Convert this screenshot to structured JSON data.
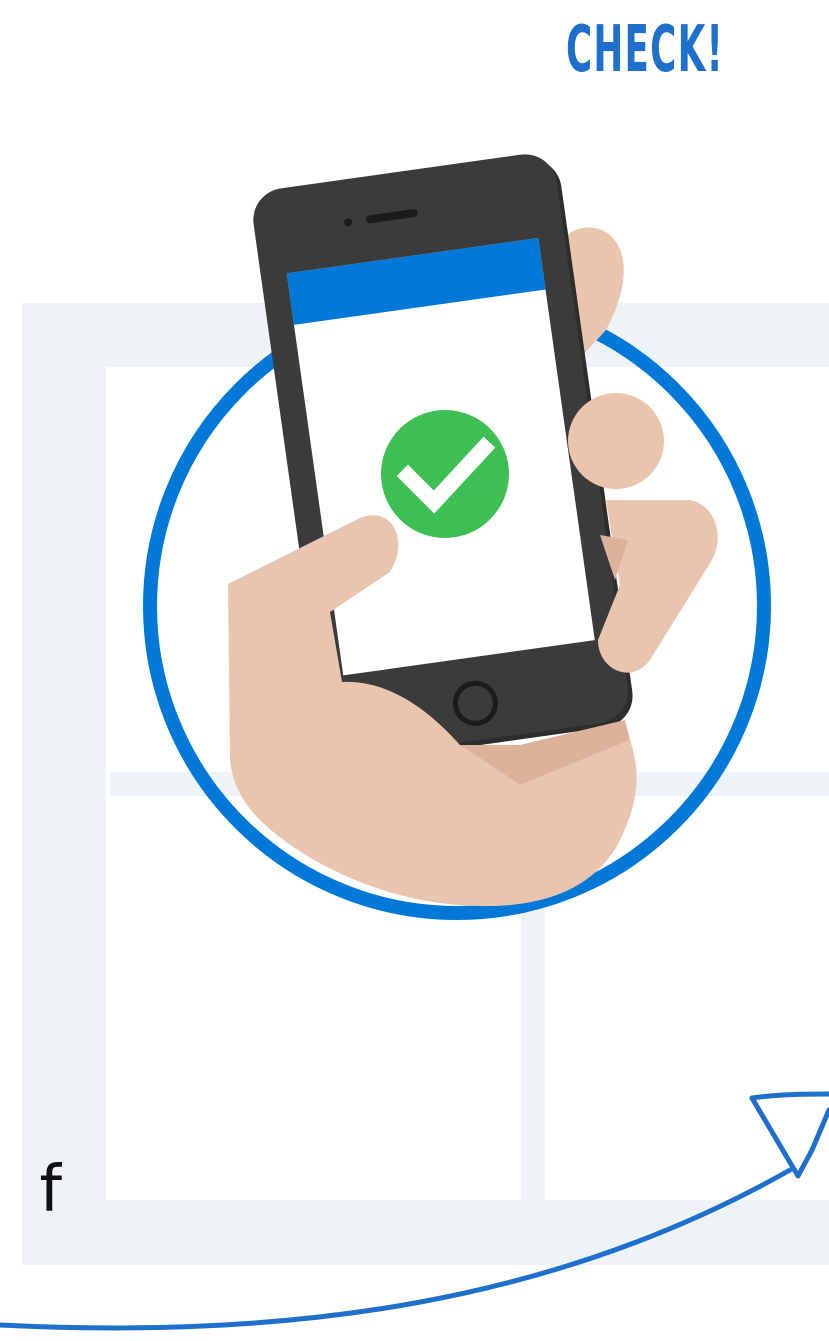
{
  "heading": {
    "text": "CHECK!"
  },
  "trailing_text": {
    "text": "f"
  },
  "colors": {
    "accent_blue": "#0078d7",
    "heading_blue": "#1f6fcc",
    "check_green": "#3dbf54",
    "skin": "#e9c5b0",
    "skin_shadow": "#dcb29b",
    "phone_body": "#3b3b3b",
    "grid_light": "#eef3f7"
  },
  "icons": {
    "status_check": "checkmark-icon",
    "home_button": "home-button-icon"
  }
}
